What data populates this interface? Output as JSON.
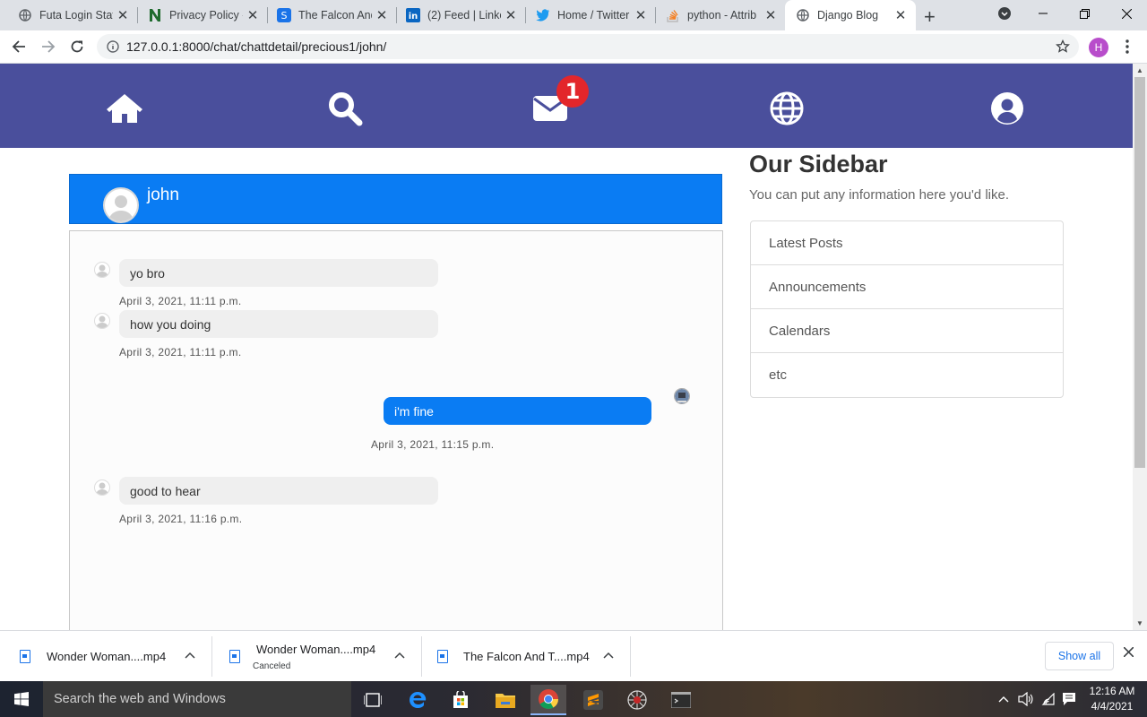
{
  "browser": {
    "tabs": [
      {
        "title": "Futa Login Stat",
        "icon": "globe-icon",
        "close": "✕"
      },
      {
        "title": "Privacy Policy -",
        "icon": "n-logo-icon",
        "close": "✕"
      },
      {
        "title": "The Falcon And",
        "icon": "s-logo-icon",
        "close": "✕"
      },
      {
        "title": "(2) Feed | Linke",
        "icon": "linkedin-icon",
        "close": "✕"
      },
      {
        "title": "Home / Twitter",
        "icon": "twitter-icon",
        "close": "✕"
      },
      {
        "title": "python - Attrib",
        "icon": "stackoverflow-icon",
        "close": "✕"
      },
      {
        "title": "Django Blog",
        "icon": "globe-icon",
        "close": "✕"
      }
    ],
    "new_tab": "+",
    "url": "127.0.0.1:8000/chat/chattdetail/precious1/john/",
    "profile_initial": "H"
  },
  "nav": {
    "items": [
      "home-icon",
      "search-icon",
      "envelope-icon",
      "globe-icon",
      "user-circle-icon"
    ],
    "badge_count": "1",
    "color": "#4a4f9c"
  },
  "chat": {
    "header_name": "john",
    "header_color": "#0a7cf3",
    "messages": [
      {
        "direction": "incoming",
        "text": "yo bro",
        "time": "April 3, 2021, 11:11 p.m."
      },
      {
        "direction": "incoming",
        "text": "how you doing",
        "time": "April 3, 2021, 11:11 p.m."
      },
      {
        "direction": "outgoing",
        "text": "i'm fine",
        "time": "April 3, 2021, 11:15 p.m."
      },
      {
        "direction": "incoming",
        "text": "good to hear",
        "time": "April 3, 2021, 11:16 p.m."
      }
    ]
  },
  "sidebar": {
    "title": "Our Sidebar",
    "text": "You can put any information here you'd like.",
    "items": [
      "Latest Posts",
      "Announcements",
      "Calendars",
      "etc"
    ]
  },
  "downloads": {
    "items": [
      {
        "name": "Wonder Woman....mp4",
        "status": ""
      },
      {
        "name": "Wonder Woman....mp4",
        "status": "Canceled"
      },
      {
        "name": "The Falcon And T....mp4",
        "status": ""
      }
    ],
    "show_all": "Show all"
  },
  "taskbar": {
    "search_placeholder": "Search the web and Windows",
    "time": "12:16 AM",
    "date": "4/4/2021"
  }
}
